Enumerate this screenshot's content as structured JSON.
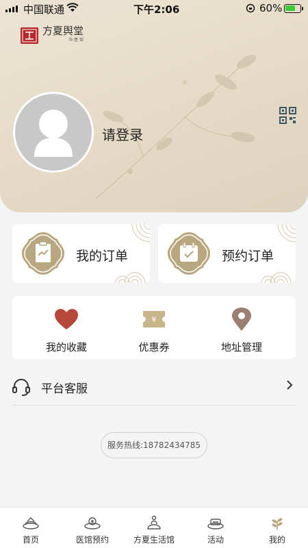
{
  "status_bar": {
    "carrier": "中国联通",
    "time": "下午2:06",
    "battery": "60%"
  },
  "logo": {
    "seal_text": "兴方堂喜",
    "brand": "方夏舆堂",
    "sub": "中 医 馆"
  },
  "profile": {
    "login_label": "请登录"
  },
  "orders": [
    {
      "label": "我的订单"
    },
    {
      "label": "预约订单"
    }
  ],
  "quick_links": [
    {
      "label": "我的收藏",
      "icon": "heart-icon",
      "color": "#b6483a"
    },
    {
      "label": "优惠券",
      "icon": "coupon-icon",
      "color": "#c8b48a"
    },
    {
      "label": "地址管理",
      "icon": "location-pin-icon",
      "color": "#9a7f72"
    }
  ],
  "service": {
    "label": "平台客服"
  },
  "hotline": "服务热线:18782434785",
  "tabs": [
    {
      "label": "首页",
      "icon": "home-icon"
    },
    {
      "label": "医馆预约",
      "icon": "clinic-booking-icon"
    },
    {
      "label": "方夏生活馆",
      "icon": "life-hall-icon"
    },
    {
      "label": "活动",
      "icon": "activity-icon"
    },
    {
      "label": "我的",
      "icon": "profile-icon"
    }
  ],
  "colors": {
    "accent_gold": "#b9a77f",
    "header_bg": "#e6dcc8",
    "seal_red": "#b6282a"
  }
}
